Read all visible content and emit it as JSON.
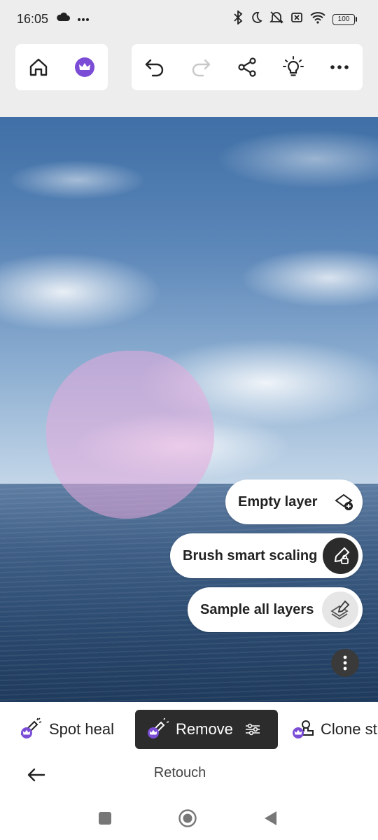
{
  "status_bar": {
    "time": "16:05",
    "battery": "100",
    "left_icons": [
      "cloud-icon",
      "more-dots-icon"
    ],
    "right_icons": [
      "bluetooth-icon",
      "dnd-moon-icon",
      "muted-icon",
      "sim-off-icon",
      "wifi-icon",
      "battery-icon"
    ]
  },
  "toolbar": {
    "left": [
      "home-icon",
      "premium-crown-icon"
    ],
    "right": [
      "undo-icon",
      "redo-icon",
      "share-icon",
      "lightbulb-icon",
      "more-icon"
    ]
  },
  "options": {
    "empty_layer": "Empty layer",
    "brush_smart_scaling": "Brush smart scaling",
    "sample_all_layers": "Sample all layers"
  },
  "tools": {
    "spot_heal": "Spot heal",
    "remove": "Remove",
    "clone_stamp": "Clone st"
  },
  "subbar": {
    "title": "Retouch"
  },
  "colors": {
    "accent_purple": "#7b4dd6",
    "active_tool_bg": "#2c2c2c",
    "mask_pink": "#e8aadc"
  }
}
